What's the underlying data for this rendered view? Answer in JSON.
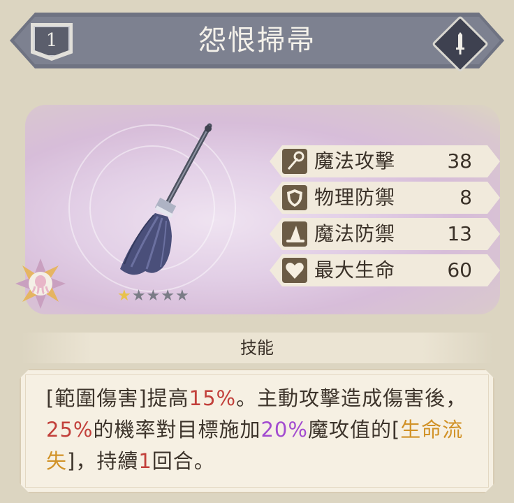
{
  "header": {
    "rank": "1",
    "title": "怨恨掃帚",
    "type_icon": "sword-icon"
  },
  "item": {
    "stars_total": 5,
    "stars_filled": 1,
    "emblem_icon": "octopus-emblem-icon"
  },
  "stats": [
    {
      "icon": "wand-icon",
      "label": "魔法攻擊",
      "value": "38"
    },
    {
      "icon": "shield-icon",
      "label": "物理防禦",
      "value": "8"
    },
    {
      "icon": "witch-hat-icon",
      "label": "魔法防禦",
      "value": "13"
    },
    {
      "icon": "heart-icon",
      "label": "最大生命",
      "value": "60"
    }
  ],
  "skill": {
    "title": "技能",
    "parts": [
      {
        "text": "[範圍傷害]提高",
        "style": "normal"
      },
      {
        "text": "15%",
        "style": "red"
      },
      {
        "text": "。主動攻擊造成傷害後，",
        "style": "normal"
      },
      {
        "text": "25%",
        "style": "red"
      },
      {
        "text": "的機率對目標施加",
        "style": "normal"
      },
      {
        "text": "20%",
        "style": "purple"
      },
      {
        "text": "魔攻值的[",
        "style": "normal"
      },
      {
        "text": "生命流失",
        "style": "orange"
      },
      {
        "text": "]，持續",
        "style": "normal"
      },
      {
        "text": "1",
        "style": "red"
      },
      {
        "text": "回合。",
        "style": "normal"
      }
    ]
  },
  "colors": {
    "banner": "#7d8190",
    "stat_icon_bg": "#6b5b45",
    "highlight_red": "#c2403b",
    "highlight_purple": "#a24bd0",
    "highlight_orange": "#d19227"
  }
}
